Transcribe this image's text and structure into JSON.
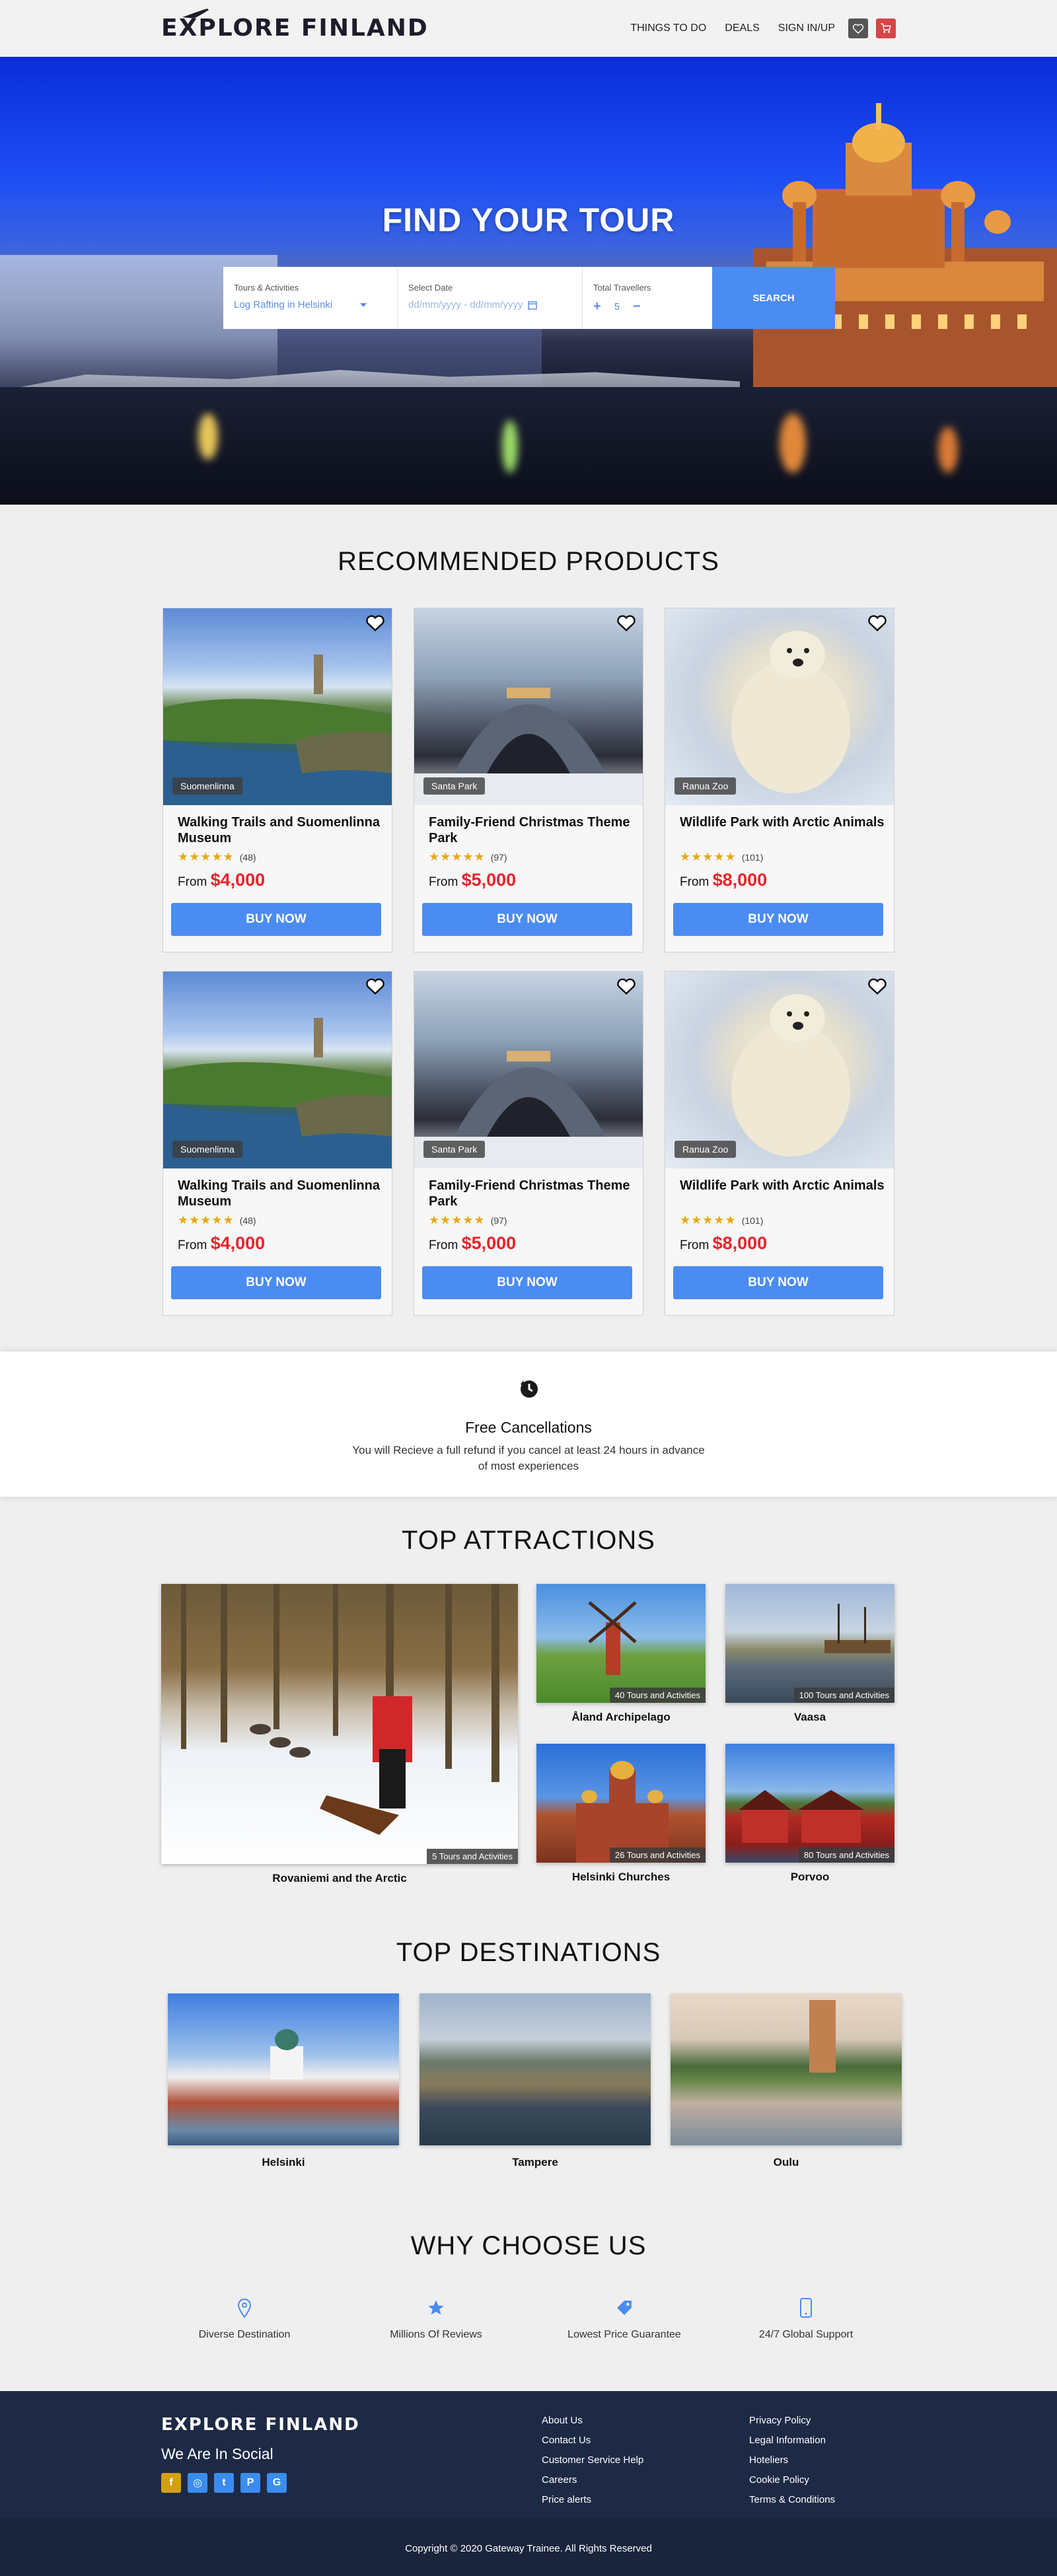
{
  "header": {
    "logo": "EXPLORE FINLAND",
    "nav": [
      "THINGS TO DO",
      "DEALS",
      "SIGN IN/UP"
    ],
    "icons": [
      "heart-icon",
      "cart-icon"
    ]
  },
  "hero": {
    "title": "FIND YOUR TOUR",
    "search": {
      "tours_label": "Tours & Activities",
      "tours_value": "Log Rafting in Helsinki",
      "date_label": "Select Date",
      "date_placeholder": "dd/mm/yyyy - dd/mm/yyyy",
      "travellers_label": "Total Travellers",
      "travellers_value": "5",
      "button": "SEARCH"
    }
  },
  "recommended": {
    "title": "RECOMMENDED PRODUCTS",
    "cards": [
      {
        "tag": "Suomenlinna",
        "name": "Walking Trails and Suomenlinna Museum",
        "rating": 4.5,
        "reviews": "(48)",
        "from": "From",
        "price": "$4,000",
        "buy": "BUY NOW"
      },
      {
        "tag": "Santa Park",
        "name": "Family-Friend Christmas Theme Park",
        "rating": 4.5,
        "reviews": "(97)",
        "from": "From",
        "price": "$5,000",
        "buy": "BUY NOW"
      },
      {
        "tag": "Ranua Zoo",
        "name": "Wildlife Park with Arctic Animals",
        "rating": 4.5,
        "reviews": "(101)",
        "from": "From",
        "price": "$8,000",
        "buy": "BUY NOW"
      },
      {
        "tag": "Suomenlinna",
        "name": "Walking Trails and Suomenlinna Museum",
        "rating": 4.5,
        "reviews": "(48)",
        "from": "From",
        "price": "$4,000",
        "buy": "BUY NOW"
      },
      {
        "tag": "Santa Park",
        "name": "Family-Friend Christmas Theme Park",
        "rating": 4.5,
        "reviews": "(97)",
        "from": "From",
        "price": "$5,000",
        "buy": "BUY NOW"
      },
      {
        "tag": "Ranua Zoo",
        "name": "Wildlife Park with Arctic Animals",
        "rating": 4.5,
        "reviews": "(101)",
        "from": "From",
        "price": "$8,000",
        "buy": "BUY NOW"
      }
    ]
  },
  "cancellation": {
    "title": "Free Cancellations",
    "desc": "You will Recieve a full refund if you cancel at least 24 hours in advance of most experiences"
  },
  "attractions": {
    "title": "TOP ATTRACTIONS",
    "items": [
      {
        "name": "Rovaniemi and the Arctic",
        "count": "5 Tours and Activities"
      },
      {
        "name": "Åland Archipelago",
        "count": "40 Tours and Activities"
      },
      {
        "name": "Vaasa",
        "count": "100 Tours and Activities"
      },
      {
        "name": "Helsinki Churches",
        "count": "26 Tours and Activities"
      },
      {
        "name": "Porvoo",
        "count": "80 Tours and Activities"
      }
    ]
  },
  "destinations": {
    "title": "TOP DESTINATIONS",
    "items": [
      "Helsinki",
      "Tampere",
      "Oulu"
    ]
  },
  "why": {
    "title": "WHY CHOOSE US",
    "items": [
      {
        "label": "Diverse Destination",
        "icon": "map-pin-icon"
      },
      {
        "label": "Millions Of Reviews",
        "icon": "star-icon"
      },
      {
        "label": "Lowest Price Guarantee",
        "icon": "price-tag-icon"
      },
      {
        "label": "24/7 Global Support",
        "icon": "phone-icon"
      }
    ]
  },
  "footer": {
    "logo": "EXPLORE FINLAND",
    "social_title": "We Are In Social",
    "social": [
      "f",
      "◎",
      "t",
      "P",
      "G"
    ],
    "col1": [
      "About Us",
      "Contact Us",
      "Customer Service Help",
      "Careers",
      "Price alerts"
    ],
    "col2": [
      "Privacy Policy",
      "Legal Information",
      "Hoteliers",
      "Cookie Policy",
      "Terms & Conditions"
    ],
    "copyright": "Copyright © 2020 Gateway Trainee. All Rights Reserved"
  },
  "colors": {
    "accent": "#4b8cf2",
    "price": "#e8232b",
    "footer": "#1e2a45",
    "stars": "#e8a817"
  }
}
